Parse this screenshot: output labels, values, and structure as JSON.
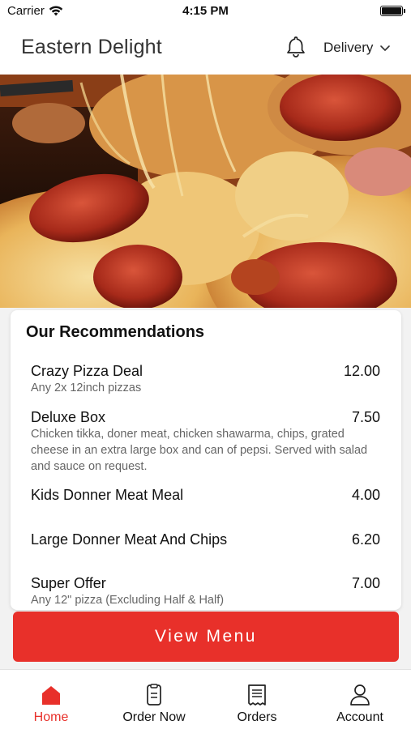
{
  "status_bar": {
    "carrier": "Carrier",
    "time": "4:15 PM"
  },
  "header": {
    "title": "Eastern Delight",
    "delivery_label": "Delivery"
  },
  "recommendations": {
    "title": "Our Recommendations",
    "items": [
      {
        "name": "Crazy Pizza Deal",
        "price": "12.00",
        "description": "Any 2x 12inch pizzas"
      },
      {
        "name": "Deluxe Box",
        "price": "7.50",
        "description": "Chicken tikka, doner meat, chicken shawarma, chips, grated cheese in an extra large box and can of pepsi. Served with salad and sauce on request."
      },
      {
        "name": "Kids Donner Meat Meal",
        "price": "4.00",
        "description": ""
      },
      {
        "name": "Large Donner Meat And Chips",
        "price": "6.20",
        "description": ""
      },
      {
        "name": "Super Offer",
        "price": "7.00",
        "description": "Any 12\" pizza (Excluding Half & Half)"
      }
    ]
  },
  "view_menu_label": "View Menu",
  "tabbar": {
    "tabs": [
      {
        "label": "Home",
        "icon": "home-icon",
        "active": true
      },
      {
        "label": "Order Now",
        "icon": "order-icon",
        "active": false
      },
      {
        "label": "Orders",
        "icon": "receipt-icon",
        "active": false
      },
      {
        "label": "Account",
        "icon": "person-icon",
        "active": false
      }
    ]
  },
  "colors": {
    "accent": "#e8302a",
    "background": "#f2f2f2",
    "card": "#ffffff"
  }
}
